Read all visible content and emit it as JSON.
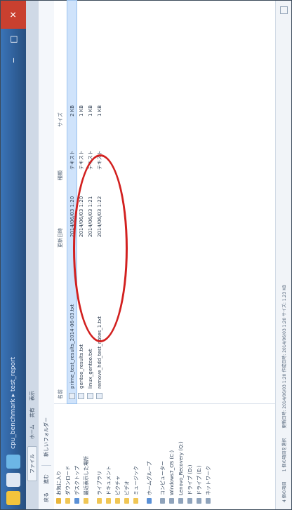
{
  "window": {
    "title": "cpu_benchmark ▸ test_report",
    "tabs": [
      "ファイル",
      "ホーム",
      "共有",
      "表示"
    ],
    "buttons": {
      "minimize": "‒",
      "maximize": "□",
      "close": "✕"
    }
  },
  "toolbar": {
    "back_label": "戻る",
    "forward_label": "進む",
    "path_label": "新しいフォルダー"
  },
  "sidebar": {
    "items": [
      {
        "label": "お気に入り",
        "icon": "star-icon"
      },
      {
        "label": "ダウンロード",
        "icon": "download-folder-icon"
      },
      {
        "label": "デスクトップ",
        "icon": "desktop-icon"
      },
      {
        "label": "最近表示した場所",
        "icon": "recent-places-icon"
      },
      {
        "label": "ライブラリ",
        "icon": "library-icon",
        "gap": true
      },
      {
        "label": "ドキュメント",
        "icon": "documents-icon"
      },
      {
        "label": "ピクチャ",
        "icon": "pictures-icon"
      },
      {
        "label": "ビデオ",
        "icon": "videos-icon"
      },
      {
        "label": "ミュージック",
        "icon": "music-icon"
      },
      {
        "label": "ホームグループ",
        "icon": "homegroup-icon",
        "gap": true
      },
      {
        "label": "コンピューター",
        "icon": "computer-icon",
        "gap": true
      },
      {
        "label": "Windows7_OS (C:)",
        "icon": "drive-icon"
      },
      {
        "label": "Lenovo_Recovery (Q:)",
        "icon": "drive-icon"
      },
      {
        "label": "ドライブ (D:)",
        "icon": "drive-icon"
      },
      {
        "label": "ドライブ (E:)",
        "icon": "drive-icon"
      },
      {
        "label": "ネットワーク",
        "icon": "network-icon"
      }
    ]
  },
  "columns": [
    "名前",
    "更新日時",
    "種類",
    "サイズ"
  ],
  "files": [
    {
      "name": "prime_test_results_2014-06-03.txt",
      "date": "2014/06/03 1:20",
      "type": "テキスト",
      "size": "2 KB",
      "selected": true
    },
    {
      "name": "gentoo_results.txt",
      "date": "2014/06/03 1:20",
      "type": "テキスト",
      "size": "1 KB",
      "selected": false
    },
    {
      "name": "linux_gentoo.txt",
      "date": "2014/06/03 1:21",
      "type": "テキスト",
      "size": "1 KB",
      "selected": false
    },
    {
      "name": "remove_hdd_test_notes_1.txt",
      "date": "2014/06/03 1:22",
      "type": "テキスト",
      "size": "1 KB",
      "selected": false
    }
  ],
  "status": {
    "items_text": "4 個の項目",
    "selected_text": "1 個の項目を選択",
    "details": "更新日時: 2014/06/03 1:20   作成日時: 2014/06/03 1:20   サイズ: 1.23 KB"
  }
}
